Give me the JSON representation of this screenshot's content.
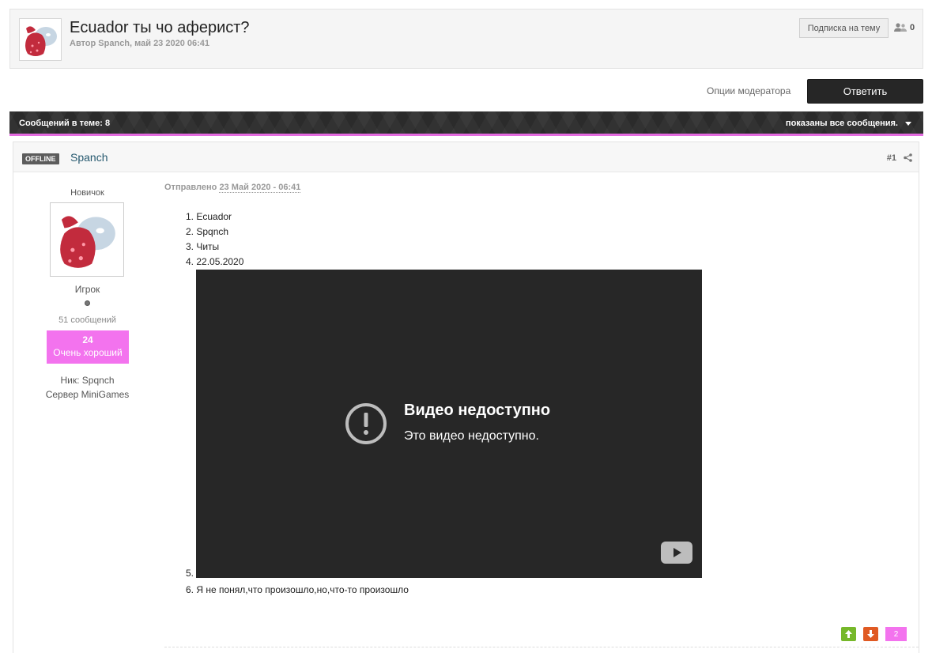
{
  "topic": {
    "title": "Ecuador ты чо аферист?",
    "meta": "Автор Spanch, май 23 2020 06:41",
    "follow_label": "Подписка на тему",
    "followers_count": "0",
    "followers_icon": "users-icon"
  },
  "actions": {
    "mod_options_label": "Опции модератора",
    "reply_label": "Ответить"
  },
  "posts_bar": {
    "count_label": "Сообщений в теме: 8",
    "shown_label": "показаны все сообщения."
  },
  "post": {
    "status": "OFFLINE",
    "author": "Spanch",
    "number": "#1",
    "group": "Новичок",
    "title": "Игрок",
    "posts_count": "51 сообщений",
    "reputation_value": "24",
    "reputation_label": "Очень хороший",
    "nick_line": "Ник: Spqnch",
    "server_line": "Сервер MiniGames",
    "posted_label": "Отправлено",
    "posted_date": "23 Май 2020 - 06:41",
    "items": [
      "1. Ecuador",
      "2. Spqnch",
      "3. Читы",
      "4. 22.05.2020",
      "5.",
      "6. Я не понял,что произошло,но,что-то произошло"
    ],
    "video_title": "Видео недоступно",
    "video_subtitle": "Это видео недоступно.",
    "vote_count": "2"
  },
  "colors": {
    "accent_pink": "#f373ee",
    "dark_bar": "#2b2b2b",
    "vote_up": "#76b82a",
    "vote_down": "#e05a23"
  }
}
